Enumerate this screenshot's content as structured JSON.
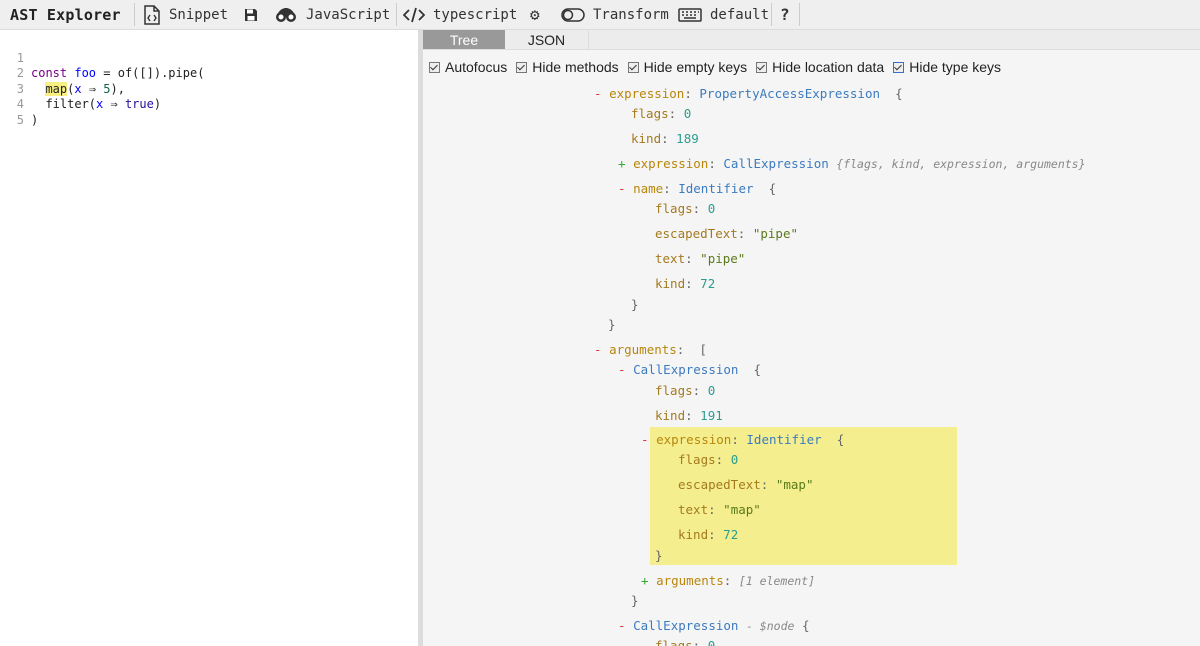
{
  "toolbar": {
    "brand": "AST Explorer",
    "snippet": "Snippet",
    "language": "JavaScript",
    "parser": "typescript",
    "transform": "Transform",
    "keymap": "default",
    "help": "?"
  },
  "editor": {
    "lines": [
      {
        "num": "1"
      },
      {
        "num": "2"
      },
      {
        "num": "3"
      },
      {
        "num": "4"
      },
      {
        "num": "5"
      }
    ],
    "tokens": {
      "const": "const",
      "foo": "foo",
      "eq": " = ",
      "of": "of([]).pipe(",
      "map": "map",
      "paren1": "(",
      "x1": "x",
      "arrow1": " ⇒ ",
      "five": "5",
      "close1": "),",
      "filter": "filter(",
      "x2": "x",
      "arrow2": " ⇒ ",
      "tru": "true",
      "close2": ")",
      "close3": ")"
    }
  },
  "tabs": {
    "tree": "Tree",
    "json": "JSON"
  },
  "options": {
    "autofocus": "Autofocus",
    "hide_methods": "Hide methods",
    "hide_empty": "Hide empty keys",
    "hide_location": "Hide location data",
    "hide_type": "Hide type keys"
  },
  "tree": {
    "expr_key": "expression",
    "expr_type": "PropertyAccessExpression",
    "flags_key": "flags",
    "flags0": "0",
    "kind_key": "kind",
    "kind189": "189",
    "expr2_key": "expression",
    "expr2_type": "CallExpression",
    "expr2_sum": "{flags, kind, expression, arguments}",
    "name_key": "name",
    "ident": "Identifier",
    "escaped_key": "escapedText",
    "pipe": "\"pipe\"",
    "text_key": "text",
    "kind72": "72",
    "args_key": "arguments",
    "call": "CallExpression",
    "kind191": "191",
    "map": "\"map\"",
    "args2_sum": "[1 element]",
    "node_label": "- $node",
    "open_brace": "{",
    "close_brace": "}",
    "open_bracket": "[",
    "colon": ":"
  }
}
